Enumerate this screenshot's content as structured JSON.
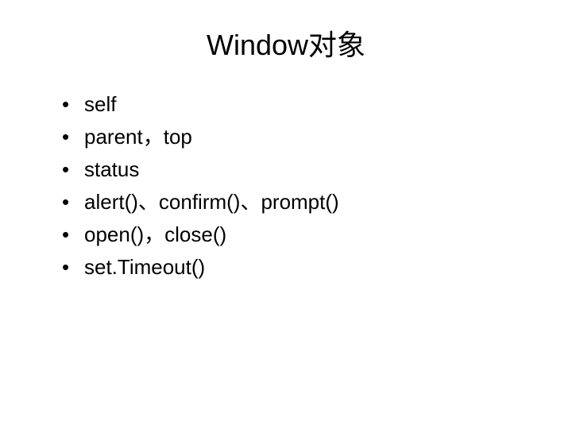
{
  "slide": {
    "title": "Window对象",
    "bullets": [
      "self",
      "parent，top",
      "status",
      "alert()、confirm()、prompt()",
      "open()，close()",
      "set.Timeout()"
    ]
  }
}
